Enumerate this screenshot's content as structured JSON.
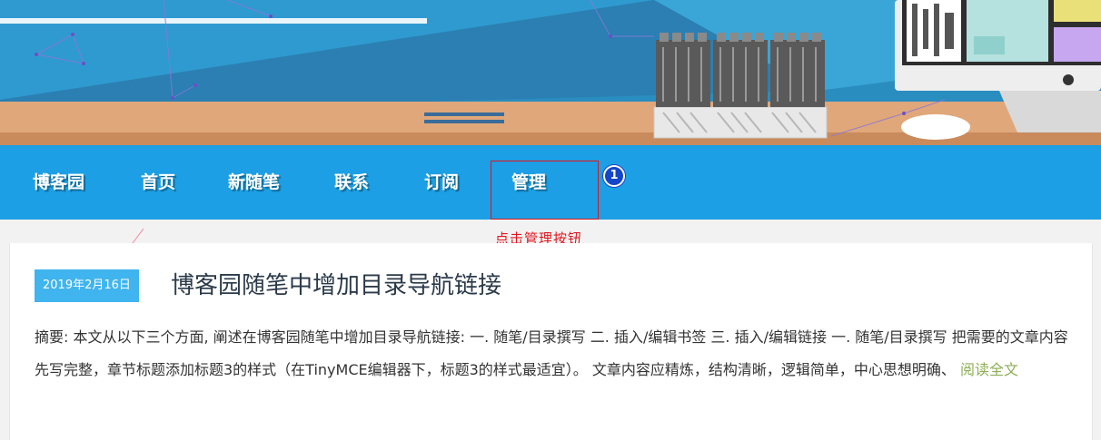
{
  "nav": {
    "items": [
      "博客园",
      "首页",
      "新随笔",
      "联系",
      "订阅",
      "管理"
    ]
  },
  "annotation": {
    "step": "1",
    "hint": "点击管理按钮"
  },
  "post": {
    "date": "2019年2月16日",
    "title": "博客园随笔中增加目录导航链接",
    "summary": "摘要: 本文从以下三个方面, 阐述在博客园随笔中增加目录导航链接: 一. 随笔/目录撰写 二. 插入/编辑书签 三. 插入/编辑链接 一. 随笔/目录撰写 把需要的文章内容先写完整，章节标题添加标题3的样式（在TinyMCE编辑器下，标题3的样式最适宜）。 文章内容应精炼，结构清晰，逻辑简单，中心思想明确、",
    "read_more": "阅读全文"
  },
  "colors": {
    "nav_bg": "#1c9fe4",
    "highlight": "#e0161e",
    "step_badge": "#1546c9",
    "date_badge": "#40b4ee",
    "read_more": "#8cae55"
  }
}
